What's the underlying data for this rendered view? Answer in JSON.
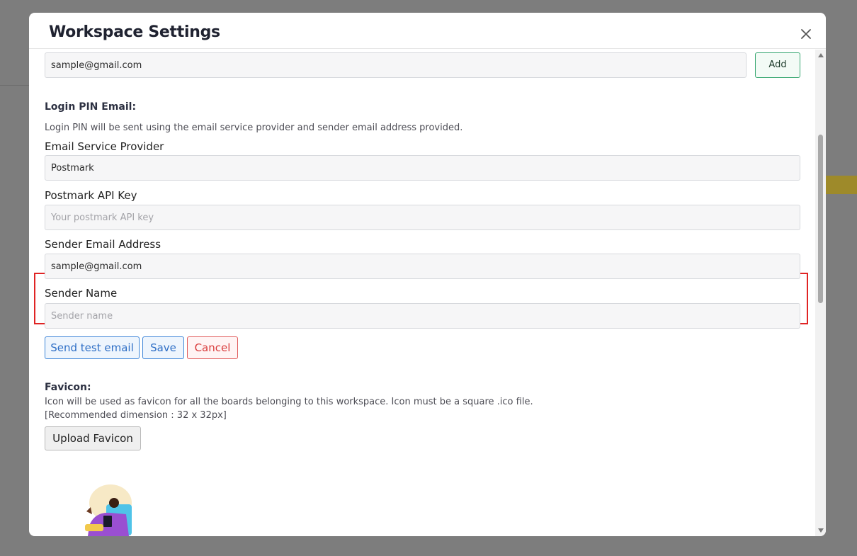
{
  "modal": {
    "title": "Workspace Settings"
  },
  "add_email": {
    "value": "sample@gmail.com",
    "button_label": "Add"
  },
  "login_pin": {
    "section_title": "Login PIN Email:",
    "help_text": "Login PIN will be sent using the email service provider and sender email address provided.",
    "provider_label": "Email Service Provider",
    "provider_value": "Postmark",
    "api_key_label": "Postmark API Key",
    "api_key_placeholder": "Your postmark API key",
    "sender_email_label": "Sender Email Address",
    "sender_email_value": "sample@gmail.com",
    "sender_name_label": "Sender Name",
    "sender_name_placeholder": "Sender name",
    "buttons": {
      "send_test": "Send test email",
      "save": "Save",
      "cancel": "Cancel"
    }
  },
  "favicon": {
    "section_title": "Favicon:",
    "help_text": "Icon will be used as favicon for all the boards belonging to this workspace. Icon must be a square .ico file.",
    "recommendation": "[Recommended dimension : 32 x 32px]",
    "upload_label": "Upload Favicon"
  },
  "icons": [
    "close-icon",
    "scroll-up-icon",
    "scroll-down-icon",
    "person-with-tablet-illustration"
  ],
  "colors": {
    "accent_blue": "#3d85d8",
    "success_green": "#3aa873",
    "danger_red": "#e05a5a",
    "highlight_red": "#e02424"
  }
}
